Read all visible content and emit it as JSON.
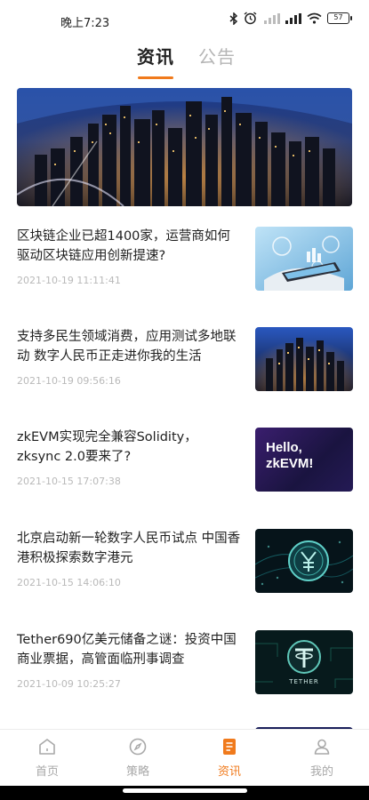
{
  "status_bar": {
    "time": "晚上7:23",
    "battery": "57"
  },
  "tabs": [
    {
      "label": "资讯",
      "active": true
    },
    {
      "label": "公告",
      "active": false
    }
  ],
  "accent_color": "#f07a1c",
  "news": [
    {
      "title": "区块链企业已超1400家，运营商如何驱动区块链应用创新提速?",
      "date": "2021-10-19 11:11:41",
      "thumb_icon": "hand-tablet-image"
    },
    {
      "title": "支持多民生领域消费，应用测试多地联动 数字人民币正走进你我的生活",
      "date": "2021-10-19 09:56:16",
      "thumb_icon": "city-night-image"
    },
    {
      "title": "zkEVM实现完全兼容Solidity，zksync 2.0要来了?",
      "date": "2021-10-15 17:07:38",
      "thumb_icon": "zkevm-image",
      "thumb_text": "Hello, zkEVM!"
    },
    {
      "title": "北京启动新一轮数字人民币试点 中国香港积极探索数字港元",
      "date": "2021-10-15 14:06:10",
      "thumb_icon": "yuan-coin-image"
    },
    {
      "title": "Tether690亿美元储备之谜：投资中国商业票据，高管面临刑事调查",
      "date": "2021-10-09 10:25:27",
      "thumb_icon": "tether-image",
      "thumb_text": "TETHER"
    }
  ],
  "bottom_nav": [
    {
      "label": "首页",
      "icon": "home-icon",
      "active": false
    },
    {
      "label": "策略",
      "icon": "compass-icon",
      "active": false
    },
    {
      "label": "资讯",
      "icon": "document-icon",
      "active": true
    },
    {
      "label": "我的",
      "icon": "user-icon",
      "active": false
    }
  ]
}
